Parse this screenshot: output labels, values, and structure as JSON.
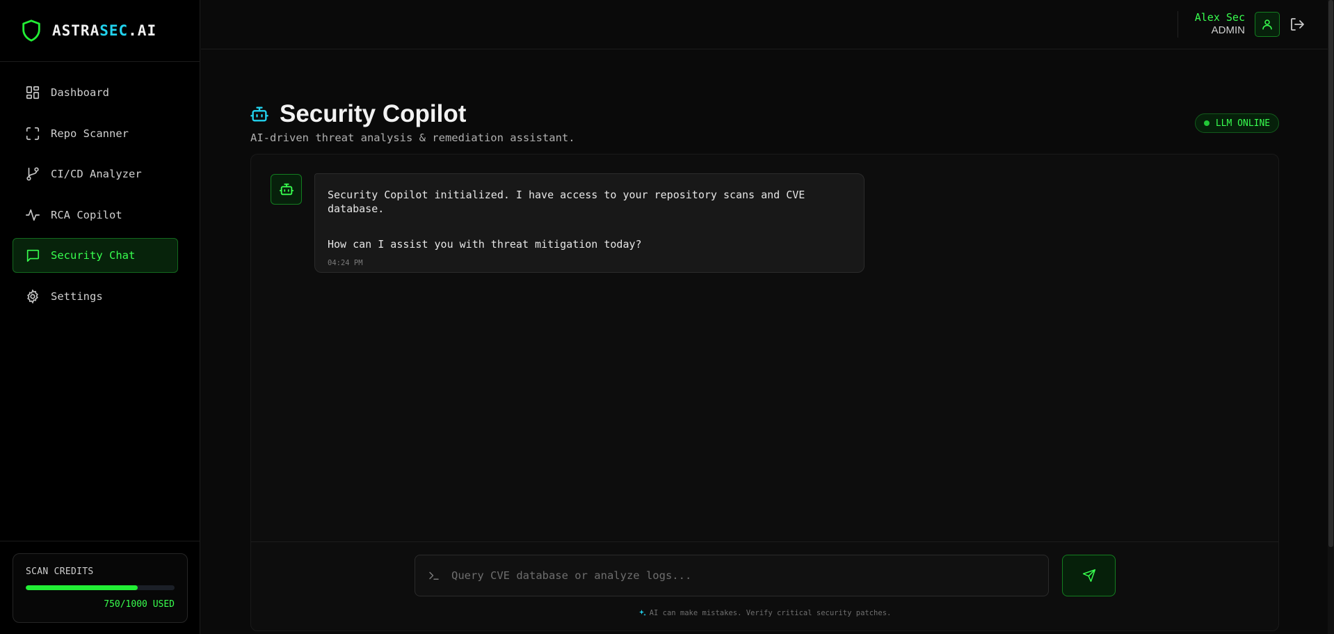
{
  "brand": {
    "part1": "ASTRA",
    "part2": "SEC",
    "part3": ".AI"
  },
  "sidebar": {
    "items": [
      {
        "label": "Dashboard",
        "icon": "layout-grid-icon"
      },
      {
        "label": "Repo Scanner",
        "icon": "scan-frame-icon"
      },
      {
        "label": "CI/CD Analyzer",
        "icon": "git-branch-icon"
      },
      {
        "label": "RCA Copilot",
        "icon": "activity-icon"
      },
      {
        "label": "Security Chat",
        "icon": "message-square-icon",
        "active": true
      },
      {
        "label": "Settings",
        "icon": "gear-icon"
      }
    ],
    "credits": {
      "title": "SCAN CREDITS",
      "used": 750,
      "total": 1000,
      "label": "750/1000 USED"
    }
  },
  "user": {
    "name": "Alex Sec",
    "role": "ADMIN"
  },
  "page": {
    "title": "Security Copilot",
    "subtitle": "AI-driven threat analysis & remediation assistant.",
    "status": "LLM ONLINE"
  },
  "chat": {
    "messages": [
      {
        "sender": "bot",
        "line1": "Security Copilot initialized. I have access to your repository scans and CVE database.",
        "line2": "How can I assist you with threat mitigation today?",
        "time": "04:24 PM"
      }
    ],
    "input": {
      "value": "",
      "placeholder": "Query CVE database or analyze logs..."
    },
    "disclaimer": "AI can make mistakes. Verify critical security patches."
  },
  "colors": {
    "accent": "#38ff4f",
    "brand_accent": "#22d3ee",
    "background": "#0a0a0a",
    "sidebar": "#000000"
  }
}
